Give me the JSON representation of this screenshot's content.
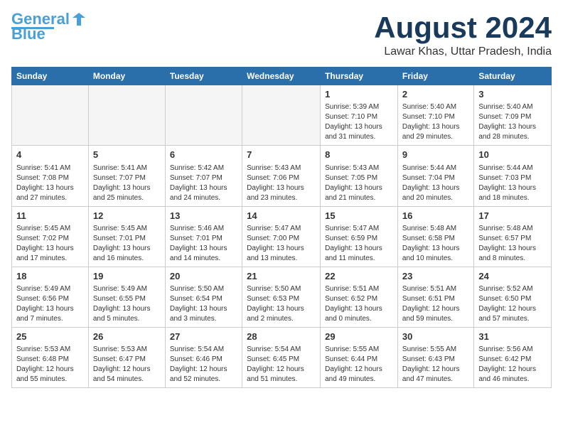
{
  "logo": {
    "line1": "General",
    "line2": "Blue"
  },
  "title": {
    "month_year": "August 2024",
    "location": "Lawar Khas, Uttar Pradesh, India"
  },
  "days_of_week": [
    "Sunday",
    "Monday",
    "Tuesday",
    "Wednesday",
    "Thursday",
    "Friday",
    "Saturday"
  ],
  "weeks": [
    [
      {
        "day": "",
        "info": ""
      },
      {
        "day": "",
        "info": ""
      },
      {
        "day": "",
        "info": ""
      },
      {
        "day": "",
        "info": ""
      },
      {
        "day": "1",
        "info": "Sunrise: 5:39 AM\nSunset: 7:10 PM\nDaylight: 13 hours\nand 31 minutes."
      },
      {
        "day": "2",
        "info": "Sunrise: 5:40 AM\nSunset: 7:10 PM\nDaylight: 13 hours\nand 29 minutes."
      },
      {
        "day": "3",
        "info": "Sunrise: 5:40 AM\nSunset: 7:09 PM\nDaylight: 13 hours\nand 28 minutes."
      }
    ],
    [
      {
        "day": "4",
        "info": "Sunrise: 5:41 AM\nSunset: 7:08 PM\nDaylight: 13 hours\nand 27 minutes."
      },
      {
        "day": "5",
        "info": "Sunrise: 5:41 AM\nSunset: 7:07 PM\nDaylight: 13 hours\nand 25 minutes."
      },
      {
        "day": "6",
        "info": "Sunrise: 5:42 AM\nSunset: 7:07 PM\nDaylight: 13 hours\nand 24 minutes."
      },
      {
        "day": "7",
        "info": "Sunrise: 5:43 AM\nSunset: 7:06 PM\nDaylight: 13 hours\nand 23 minutes."
      },
      {
        "day": "8",
        "info": "Sunrise: 5:43 AM\nSunset: 7:05 PM\nDaylight: 13 hours\nand 21 minutes."
      },
      {
        "day": "9",
        "info": "Sunrise: 5:44 AM\nSunset: 7:04 PM\nDaylight: 13 hours\nand 20 minutes."
      },
      {
        "day": "10",
        "info": "Sunrise: 5:44 AM\nSunset: 7:03 PM\nDaylight: 13 hours\nand 18 minutes."
      }
    ],
    [
      {
        "day": "11",
        "info": "Sunrise: 5:45 AM\nSunset: 7:02 PM\nDaylight: 13 hours\nand 17 minutes."
      },
      {
        "day": "12",
        "info": "Sunrise: 5:45 AM\nSunset: 7:01 PM\nDaylight: 13 hours\nand 16 minutes."
      },
      {
        "day": "13",
        "info": "Sunrise: 5:46 AM\nSunset: 7:01 PM\nDaylight: 13 hours\nand 14 minutes."
      },
      {
        "day": "14",
        "info": "Sunrise: 5:47 AM\nSunset: 7:00 PM\nDaylight: 13 hours\nand 13 minutes."
      },
      {
        "day": "15",
        "info": "Sunrise: 5:47 AM\nSunset: 6:59 PM\nDaylight: 13 hours\nand 11 minutes."
      },
      {
        "day": "16",
        "info": "Sunrise: 5:48 AM\nSunset: 6:58 PM\nDaylight: 13 hours\nand 10 minutes."
      },
      {
        "day": "17",
        "info": "Sunrise: 5:48 AM\nSunset: 6:57 PM\nDaylight: 13 hours\nand 8 minutes."
      }
    ],
    [
      {
        "day": "18",
        "info": "Sunrise: 5:49 AM\nSunset: 6:56 PM\nDaylight: 13 hours\nand 7 minutes."
      },
      {
        "day": "19",
        "info": "Sunrise: 5:49 AM\nSunset: 6:55 PM\nDaylight: 13 hours\nand 5 minutes."
      },
      {
        "day": "20",
        "info": "Sunrise: 5:50 AM\nSunset: 6:54 PM\nDaylight: 13 hours\nand 3 minutes."
      },
      {
        "day": "21",
        "info": "Sunrise: 5:50 AM\nSunset: 6:53 PM\nDaylight: 13 hours\nand 2 minutes."
      },
      {
        "day": "22",
        "info": "Sunrise: 5:51 AM\nSunset: 6:52 PM\nDaylight: 13 hours\nand 0 minutes."
      },
      {
        "day": "23",
        "info": "Sunrise: 5:51 AM\nSunset: 6:51 PM\nDaylight: 12 hours\nand 59 minutes."
      },
      {
        "day": "24",
        "info": "Sunrise: 5:52 AM\nSunset: 6:50 PM\nDaylight: 12 hours\nand 57 minutes."
      }
    ],
    [
      {
        "day": "25",
        "info": "Sunrise: 5:53 AM\nSunset: 6:48 PM\nDaylight: 12 hours\nand 55 minutes."
      },
      {
        "day": "26",
        "info": "Sunrise: 5:53 AM\nSunset: 6:47 PM\nDaylight: 12 hours\nand 54 minutes."
      },
      {
        "day": "27",
        "info": "Sunrise: 5:54 AM\nSunset: 6:46 PM\nDaylight: 12 hours\nand 52 minutes."
      },
      {
        "day": "28",
        "info": "Sunrise: 5:54 AM\nSunset: 6:45 PM\nDaylight: 12 hours\nand 51 minutes."
      },
      {
        "day": "29",
        "info": "Sunrise: 5:55 AM\nSunset: 6:44 PM\nDaylight: 12 hours\nand 49 minutes."
      },
      {
        "day": "30",
        "info": "Sunrise: 5:55 AM\nSunset: 6:43 PM\nDaylight: 12 hours\nand 47 minutes."
      },
      {
        "day": "31",
        "info": "Sunrise: 5:56 AM\nSunset: 6:42 PM\nDaylight: 12 hours\nand 46 minutes."
      }
    ]
  ]
}
